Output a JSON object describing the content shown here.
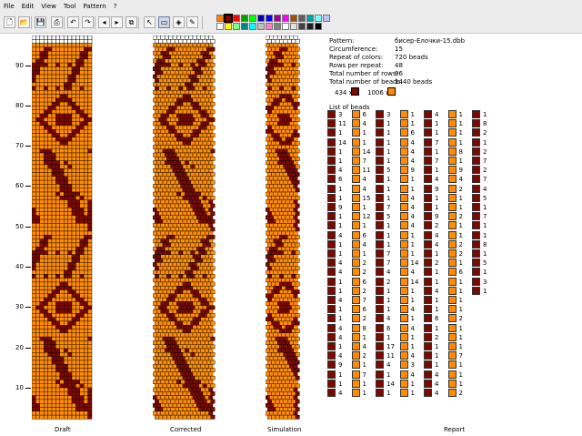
{
  "menu": {
    "items": [
      "File",
      "Edit",
      "View",
      "Tool",
      "Pattern",
      "?"
    ]
  },
  "toolbar": {
    "buttons": [
      {
        "name": "new-file-icon",
        "glyph": "🗋"
      },
      {
        "name": "open-file-icon",
        "glyph": "📂"
      },
      {
        "name": "save-file-icon",
        "glyph": "💾"
      },
      {
        "name": "print-icon",
        "glyph": "⎙"
      },
      {
        "name": "undo-icon",
        "glyph": "↶"
      },
      {
        "name": "redo-icon",
        "glyph": "↷"
      },
      {
        "name": "arrow-left-icon",
        "glyph": "◂"
      },
      {
        "name": "arrow-right-icon",
        "glyph": "▸"
      },
      {
        "name": "copy-icon",
        "glyph": "⧉"
      },
      {
        "name": "pointer-icon",
        "glyph": "↖"
      },
      {
        "name": "select-rect-icon",
        "glyph": "▭"
      },
      {
        "name": "fill-icon",
        "glyph": "◈"
      },
      {
        "name": "eyedropper-icon",
        "glyph": "✎"
      }
    ]
  },
  "palette": {
    "row1": [
      "#ff8000",
      "#800000",
      "#ff0000",
      "#00a000",
      "#00ff00",
      "#0000a0",
      "#0000ff",
      "#a000a0",
      "#ff00ff",
      "#a05000",
      "#606060",
      "#00a0a0",
      "#80ffff",
      "#c0c0ff"
    ],
    "row2": [
      "#ffffff",
      "#ffff00",
      "#80ff80",
      "#008080",
      "#00ffff",
      "#c0c0c0",
      "#ff80c0",
      "#808080",
      "#ffffff",
      "#e0e0e0",
      "#404040",
      "#202020",
      "#000000"
    ]
  },
  "colors": {
    "dark": "#7a0a00",
    "orange": "#ff8c00",
    "white": "#ffffff"
  },
  "ruler": {
    "labels": [
      "90",
      "80",
      "70",
      "60",
      "50",
      "40",
      "30",
      "20",
      "10"
    ]
  },
  "panes": {
    "draft": "Draft",
    "corrected": "Corrected",
    "simulation": "Simulation",
    "report": "Report"
  },
  "info": {
    "pattern_label": "Pattern:",
    "pattern_value": "бисер-Елочки-15.dbb",
    "circumference_label": "Circumference:",
    "circumference_value": "15",
    "repeat_label": "Repeat of colors:",
    "repeat_value": "720 beads",
    "rows_repeat_label": "Rows per repeat:",
    "rows_repeat_value": "48",
    "total_rows_label": "Total number of rows:",
    "total_rows_value": "96",
    "total_beads_label": "Total number of beads:",
    "total_beads_value": "1440 beads",
    "count_dark": "434 x",
    "count_orange": "1006 x",
    "list_label": "List of beads"
  },
  "beads": {
    "columns": [
      [
        [
          "d",
          "3"
        ],
        [
          "d",
          "11"
        ],
        [
          "d",
          "1"
        ],
        [
          "d",
          "14"
        ],
        [
          "d",
          "1"
        ],
        [
          "d",
          "1"
        ],
        [
          "d",
          "4"
        ],
        [
          "d",
          "6"
        ],
        [
          "d",
          "1"
        ],
        [
          "d",
          "1"
        ],
        [
          "d",
          "9"
        ],
        [
          "d",
          "1"
        ],
        [
          "d",
          "1"
        ],
        [
          "d",
          "4"
        ],
        [
          "d",
          "1"
        ],
        [
          "d",
          "1"
        ],
        [
          "d",
          "4"
        ],
        [
          "d",
          "4"
        ],
        [
          "d",
          "1"
        ],
        [
          "d",
          "1"
        ],
        [
          "d",
          "4"
        ],
        [
          "d",
          "1"
        ],
        [
          "d",
          "1"
        ],
        [
          "d",
          "4"
        ],
        [
          "d",
          "4"
        ],
        [
          "d",
          "1"
        ],
        [
          "d",
          "4"
        ],
        [
          "d",
          "9"
        ],
        [
          "d",
          "1"
        ],
        [
          "d",
          "1"
        ],
        [
          "d",
          "4"
        ]
      ],
      [
        [
          "o",
          "6"
        ],
        [
          "o",
          "4"
        ],
        [
          "o",
          "1"
        ],
        [
          "o",
          "1"
        ],
        [
          "o",
          "14"
        ],
        [
          "o",
          "7"
        ],
        [
          "o",
          "11"
        ],
        [
          "o",
          "4"
        ],
        [
          "o",
          "4"
        ],
        [
          "o",
          "15"
        ],
        [
          "o",
          "1"
        ],
        [
          "o",
          "12"
        ],
        [
          "o",
          "1"
        ],
        [
          "o",
          "6"
        ],
        [
          "o",
          "4"
        ],
        [
          "o",
          "1"
        ],
        [
          "o",
          "2"
        ],
        [
          "o",
          "2"
        ],
        [
          "o",
          "6"
        ],
        [
          "o",
          "2"
        ],
        [
          "o",
          "7"
        ],
        [
          "o",
          "6"
        ],
        [
          "o",
          "2"
        ],
        [
          "o",
          "8"
        ],
        [
          "o",
          "1"
        ],
        [
          "o",
          "4"
        ],
        [
          "o",
          "2"
        ],
        [
          "o",
          "1"
        ],
        [
          "o",
          "7"
        ],
        [
          "o",
          "1"
        ],
        [
          "o",
          "1"
        ]
      ],
      [
        [
          "d",
          "3"
        ],
        [
          "d",
          "1"
        ],
        [
          "d",
          "1"
        ],
        [
          "d",
          "1"
        ],
        [
          "d",
          "1"
        ],
        [
          "d",
          "1"
        ],
        [
          "d",
          "5"
        ],
        [
          "d",
          "1"
        ],
        [
          "d",
          "1"
        ],
        [
          "d",
          "1"
        ],
        [
          "d",
          "7"
        ],
        [
          "d",
          "5"
        ],
        [
          "d",
          "1"
        ],
        [
          "d",
          "1"
        ],
        [
          "d",
          "1"
        ],
        [
          "d",
          "7"
        ],
        [
          "d",
          "7"
        ],
        [
          "d",
          "4"
        ],
        [
          "d",
          "2"
        ],
        [
          "d",
          "1"
        ],
        [
          "d",
          "1"
        ],
        [
          "d",
          "1"
        ],
        [
          "d",
          "4"
        ],
        [
          "d",
          "6"
        ],
        [
          "d",
          "1"
        ],
        [
          "d",
          "17"
        ],
        [
          "d",
          "11"
        ],
        [
          "d",
          "4"
        ],
        [
          "d",
          "1"
        ],
        [
          "d",
          "14"
        ],
        [
          "d",
          "1"
        ]
      ],
      [
        [
          "o",
          "1"
        ],
        [
          "o",
          "1"
        ],
        [
          "o",
          "6"
        ],
        [
          "o",
          "4"
        ],
        [
          "o",
          "4"
        ],
        [
          "o",
          "4"
        ],
        [
          "o",
          "9"
        ],
        [
          "o",
          "1"
        ],
        [
          "o",
          "1"
        ],
        [
          "o",
          "4"
        ],
        [
          "o",
          "4"
        ],
        [
          "o",
          "4"
        ],
        [
          "o",
          "4"
        ],
        [
          "o",
          "1"
        ],
        [
          "o",
          "1"
        ],
        [
          "o",
          "1"
        ],
        [
          "o",
          "14"
        ],
        [
          "o",
          "4"
        ],
        [
          "o",
          "14"
        ],
        [
          "o",
          "1"
        ],
        [
          "o",
          "1"
        ],
        [
          "o",
          "4"
        ],
        [
          "o",
          "1"
        ],
        [
          "o",
          "4"
        ],
        [
          "o",
          "1"
        ],
        [
          "o",
          "1"
        ],
        [
          "o",
          "4"
        ],
        [
          "o",
          "3"
        ],
        [
          "o",
          "4"
        ],
        [
          "o",
          "1"
        ],
        [
          "o",
          "1"
        ]
      ],
      [
        [
          "d",
          "4"
        ],
        [
          "d",
          "1"
        ],
        [
          "d",
          "1"
        ],
        [
          "d",
          "7"
        ],
        [
          "d",
          "1"
        ],
        [
          "d",
          "7"
        ],
        [
          "d",
          "1"
        ],
        [
          "d",
          "4"
        ],
        [
          "d",
          "9"
        ],
        [
          "d",
          "1"
        ],
        [
          "d",
          "1"
        ],
        [
          "d",
          "9"
        ],
        [
          "d",
          "2"
        ],
        [
          "d",
          "4"
        ],
        [
          "d",
          "4"
        ],
        [
          "d",
          "1"
        ],
        [
          "d",
          "2"
        ],
        [
          "d",
          "1"
        ],
        [
          "d",
          "1"
        ],
        [
          "d",
          "4"
        ],
        [
          "d",
          "1"
        ],
        [
          "d",
          "1"
        ],
        [
          "d",
          "6"
        ],
        [
          "d",
          "1"
        ],
        [
          "d",
          "2"
        ],
        [
          "d",
          "1"
        ],
        [
          "d",
          "1"
        ],
        [
          "d",
          "1"
        ],
        [
          "d",
          "4"
        ],
        [
          "d",
          "4"
        ],
        [
          "d",
          "4"
        ]
      ],
      [
        [
          "o",
          "1"
        ],
        [
          "o",
          "1"
        ],
        [
          "o",
          "1"
        ],
        [
          "o",
          "1"
        ],
        [
          "o",
          "8"
        ],
        [
          "o",
          "1"
        ],
        [
          "o",
          "9"
        ],
        [
          "o",
          "4"
        ],
        [
          "o",
          "2"
        ],
        [
          "o",
          "1"
        ],
        [
          "o",
          "1"
        ],
        [
          "o",
          "2"
        ],
        [
          "o",
          "1"
        ],
        [
          "o",
          "1"
        ],
        [
          "o",
          "2"
        ],
        [
          "o",
          "2"
        ],
        [
          "o",
          "1"
        ],
        [
          "o",
          "6"
        ],
        [
          "o",
          "1"
        ],
        [
          "o",
          "1"
        ],
        [
          "o",
          "1"
        ],
        [
          "o",
          "1"
        ],
        [
          "o",
          "2"
        ],
        [
          "o",
          "1"
        ],
        [
          "o",
          "1"
        ],
        [
          "o",
          "1"
        ],
        [
          "o",
          "7"
        ],
        [
          "o",
          "1"
        ],
        [
          "o",
          "1"
        ],
        [
          "o",
          "1"
        ],
        [
          "o",
          "2"
        ]
      ],
      [
        [
          "d",
          "1"
        ],
        [
          "d",
          "8"
        ],
        [
          "d",
          "2"
        ],
        [
          "d",
          "1"
        ],
        [
          "d",
          "2"
        ],
        [
          "d",
          "7"
        ],
        [
          "d",
          "2"
        ],
        [
          "d",
          "7"
        ],
        [
          "d",
          "4"
        ],
        [
          "d",
          "5"
        ],
        [
          "d",
          "1"
        ],
        [
          "d",
          "7"
        ],
        [
          "d",
          "1"
        ],
        [
          "d",
          "1"
        ],
        [
          "d",
          "8"
        ],
        [
          "d",
          "1"
        ],
        [
          "d",
          "5"
        ],
        [
          "d",
          "1"
        ],
        [
          "d",
          "3"
        ],
        [
          "d",
          "1"
        ]
      ]
    ]
  }
}
